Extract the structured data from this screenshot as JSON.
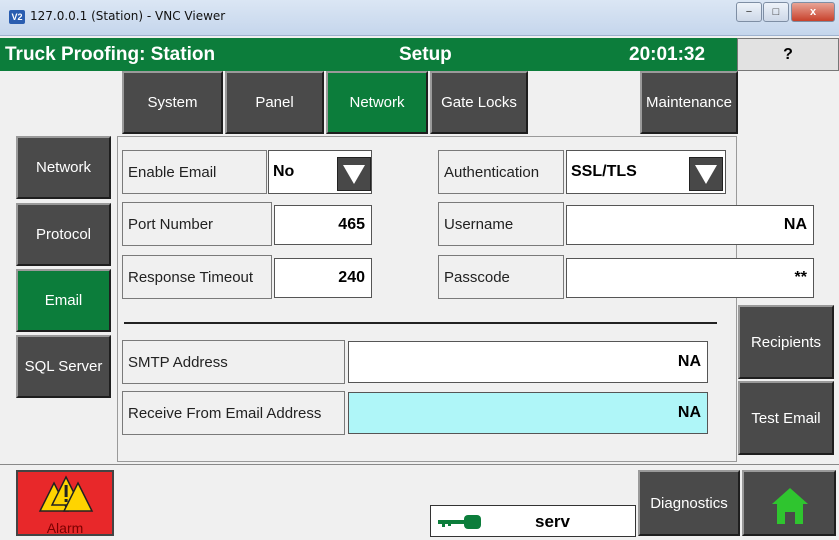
{
  "window": {
    "icon_label": "V2",
    "title": "127.0.0.1 (Station) - VNC Viewer",
    "min": "−",
    "max": "□",
    "close": "x"
  },
  "header": {
    "app_title": "Truck Proofing: Station",
    "screen_title": "Setup",
    "clock": "20:01:32",
    "help": "?"
  },
  "tabs": [
    {
      "label": "System"
    },
    {
      "label": "Panel"
    },
    {
      "label": "Network",
      "active": true
    },
    {
      "label": "Gate Locks"
    },
    {
      "label": "Maintenance"
    }
  ],
  "side_nav": [
    {
      "label": "Network"
    },
    {
      "label": "Protocol"
    },
    {
      "label": "Email",
      "active": true
    },
    {
      "label": "SQL Server"
    }
  ],
  "email": {
    "enable_email": {
      "label": "Enable Email",
      "value": "No"
    },
    "port_number": {
      "label": "Port Number",
      "value": "465"
    },
    "response_timeout": {
      "label": "Response Timeout",
      "value": "240"
    },
    "authentication": {
      "label": "Authentication",
      "value": "SSL/TLS"
    },
    "username": {
      "label": "Username",
      "value": "NA"
    },
    "passcode": {
      "label": "Passcode",
      "value": "**"
    },
    "smtp_address": {
      "label": "SMTP Address",
      "value": "NA"
    },
    "receive_from": {
      "label": "Receive From Email Address",
      "value": "NA"
    }
  },
  "buttons": {
    "recipients": "Recipients",
    "test_email": "Test Email",
    "diagnostics": "Diagnostics"
  },
  "footer": {
    "alarm": "Alarm",
    "user": "serv"
  },
  "colors": {
    "header_green": "#0c7d3b",
    "button_gray": "#4a4a4a",
    "highlight_cyan": "#aff6f8",
    "alarm_red": "#e8282a",
    "warning_yellow": "#ffd400",
    "home_green": "#2fc52f"
  },
  "icons": {
    "alarm": "warning-triangles-icon",
    "home": "home-icon",
    "key": "key-icon",
    "dropdown": "triangle-down-icon"
  }
}
